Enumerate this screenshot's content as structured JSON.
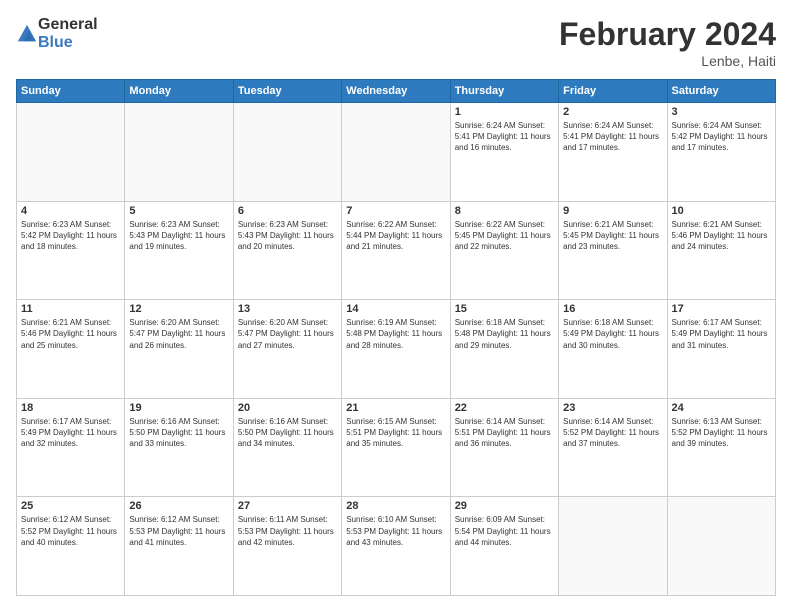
{
  "header": {
    "title": "February 2024",
    "location": "Lenbe, Haiti",
    "logo_general": "General",
    "logo_blue": "Blue"
  },
  "days_of_week": [
    "Sunday",
    "Monday",
    "Tuesday",
    "Wednesday",
    "Thursday",
    "Friday",
    "Saturday"
  ],
  "weeks": [
    [
      {
        "day": "",
        "info": ""
      },
      {
        "day": "",
        "info": ""
      },
      {
        "day": "",
        "info": ""
      },
      {
        "day": "",
        "info": ""
      },
      {
        "day": "1",
        "info": "Sunrise: 6:24 AM\nSunset: 5:41 PM\nDaylight: 11 hours and 16 minutes."
      },
      {
        "day": "2",
        "info": "Sunrise: 6:24 AM\nSunset: 5:41 PM\nDaylight: 11 hours and 17 minutes."
      },
      {
        "day": "3",
        "info": "Sunrise: 6:24 AM\nSunset: 5:42 PM\nDaylight: 11 hours and 17 minutes."
      }
    ],
    [
      {
        "day": "4",
        "info": "Sunrise: 6:23 AM\nSunset: 5:42 PM\nDaylight: 11 hours and 18 minutes."
      },
      {
        "day": "5",
        "info": "Sunrise: 6:23 AM\nSunset: 5:43 PM\nDaylight: 11 hours and 19 minutes."
      },
      {
        "day": "6",
        "info": "Sunrise: 6:23 AM\nSunset: 5:43 PM\nDaylight: 11 hours and 20 minutes."
      },
      {
        "day": "7",
        "info": "Sunrise: 6:22 AM\nSunset: 5:44 PM\nDaylight: 11 hours and 21 minutes."
      },
      {
        "day": "8",
        "info": "Sunrise: 6:22 AM\nSunset: 5:45 PM\nDaylight: 11 hours and 22 minutes."
      },
      {
        "day": "9",
        "info": "Sunrise: 6:21 AM\nSunset: 5:45 PM\nDaylight: 11 hours and 23 minutes."
      },
      {
        "day": "10",
        "info": "Sunrise: 6:21 AM\nSunset: 5:46 PM\nDaylight: 11 hours and 24 minutes."
      }
    ],
    [
      {
        "day": "11",
        "info": "Sunrise: 6:21 AM\nSunset: 5:46 PM\nDaylight: 11 hours and 25 minutes."
      },
      {
        "day": "12",
        "info": "Sunrise: 6:20 AM\nSunset: 5:47 PM\nDaylight: 11 hours and 26 minutes."
      },
      {
        "day": "13",
        "info": "Sunrise: 6:20 AM\nSunset: 5:47 PM\nDaylight: 11 hours and 27 minutes."
      },
      {
        "day": "14",
        "info": "Sunrise: 6:19 AM\nSunset: 5:48 PM\nDaylight: 11 hours and 28 minutes."
      },
      {
        "day": "15",
        "info": "Sunrise: 6:18 AM\nSunset: 5:48 PM\nDaylight: 11 hours and 29 minutes."
      },
      {
        "day": "16",
        "info": "Sunrise: 6:18 AM\nSunset: 5:49 PM\nDaylight: 11 hours and 30 minutes."
      },
      {
        "day": "17",
        "info": "Sunrise: 6:17 AM\nSunset: 5:49 PM\nDaylight: 11 hours and 31 minutes."
      }
    ],
    [
      {
        "day": "18",
        "info": "Sunrise: 6:17 AM\nSunset: 5:49 PM\nDaylight: 11 hours and 32 minutes."
      },
      {
        "day": "19",
        "info": "Sunrise: 6:16 AM\nSunset: 5:50 PM\nDaylight: 11 hours and 33 minutes."
      },
      {
        "day": "20",
        "info": "Sunrise: 6:16 AM\nSunset: 5:50 PM\nDaylight: 11 hours and 34 minutes."
      },
      {
        "day": "21",
        "info": "Sunrise: 6:15 AM\nSunset: 5:51 PM\nDaylight: 11 hours and 35 minutes."
      },
      {
        "day": "22",
        "info": "Sunrise: 6:14 AM\nSunset: 5:51 PM\nDaylight: 11 hours and 36 minutes."
      },
      {
        "day": "23",
        "info": "Sunrise: 6:14 AM\nSunset: 5:52 PM\nDaylight: 11 hours and 37 minutes."
      },
      {
        "day": "24",
        "info": "Sunrise: 6:13 AM\nSunset: 5:52 PM\nDaylight: 11 hours and 39 minutes."
      }
    ],
    [
      {
        "day": "25",
        "info": "Sunrise: 6:12 AM\nSunset: 5:52 PM\nDaylight: 11 hours and 40 minutes."
      },
      {
        "day": "26",
        "info": "Sunrise: 6:12 AM\nSunset: 5:53 PM\nDaylight: 11 hours and 41 minutes."
      },
      {
        "day": "27",
        "info": "Sunrise: 6:11 AM\nSunset: 5:53 PM\nDaylight: 11 hours and 42 minutes."
      },
      {
        "day": "28",
        "info": "Sunrise: 6:10 AM\nSunset: 5:53 PM\nDaylight: 11 hours and 43 minutes."
      },
      {
        "day": "29",
        "info": "Sunrise: 6:09 AM\nSunset: 5:54 PM\nDaylight: 11 hours and 44 minutes."
      },
      {
        "day": "",
        "info": ""
      },
      {
        "day": "",
        "info": ""
      }
    ]
  ]
}
